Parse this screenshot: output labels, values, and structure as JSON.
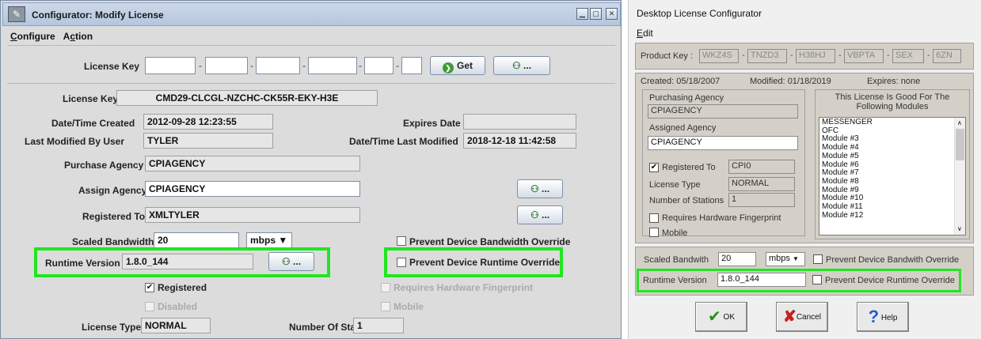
{
  "left": {
    "title": "Configurator: Modify License",
    "menu": [
      "Configure",
      "Action"
    ],
    "license_key_label": "License Key",
    "get_button": "Get",
    "more_button": "...",
    "key_display_label": "License Key",
    "key_display_value": "CMD29-CLCGL-NZCHC-CK55R-EKY-H3E",
    "created_label": "Date/Time Created",
    "created_value": "2012-09-28 12:23:55",
    "expires_label": "Expires Date",
    "expires_value": "",
    "modified_user_label": "Last Modified By User",
    "modified_user_value": "TYLER",
    "modified_label": "Date/Time Last Modified",
    "modified_value": "2018-12-18 11:42:58",
    "purchase_label": "Purchase Agency",
    "purchase_value": "CPIAGENCY",
    "assign_label": "Assign Agency",
    "assign_value": "CPIAGENCY",
    "registered_to_label": "Registered To",
    "registered_to_value": "XMLTYLER",
    "bandwidth_label": "Scaled Bandwidth",
    "bandwidth_value": "20",
    "bandwidth_unit": "mbps",
    "prevent_bandwidth": "Prevent Device Bandwidth Override",
    "runtime_label": "Runtime Version",
    "runtime_value": "1.8.0_144",
    "prevent_runtime": "Prevent Device Runtime Override",
    "registered": "Registered",
    "requires_hw": "Requires Hardware Fingerprint",
    "disabled": "Disabled",
    "mobile": "Mobile",
    "license_type_label": "License Type",
    "license_type_value": "NORMAL",
    "stations_label": "Number Of Stations",
    "stations_value": "1"
  },
  "right": {
    "title": "Desktop License Configurator",
    "menu": "Edit",
    "product_key_label": "Product Key :",
    "product_key": [
      "WKZ4S",
      "TNZD3",
      "H38HJ",
      "VBPTA",
      "SEX",
      "6ZN"
    ],
    "created": "Created: 05/18/2007",
    "modified": "Modified: 01/18/2019",
    "expires": "Expires: none",
    "purchasing_label": "Purchasing Agency",
    "purchasing_value": "CPIAGENCY",
    "assigned_label": "Assigned Agency",
    "assigned_value": "CPIAGENCY",
    "registered_to_label": "Registered To",
    "registered_to_value": "CPI0",
    "license_type_label": "License Type",
    "license_type_value": "NORMAL",
    "stations_label": "Number of Stations",
    "stations_value": "1",
    "requires_hw": "Requires Hardware Fingerprint",
    "mobile": "Mobile",
    "modules_header": "This License Is Good For The Following Modules",
    "modules": [
      "MESSENGER",
      "OFC",
      "Module #3",
      "Module #4",
      "Module #5",
      "Module #6",
      "Module #7",
      "Module #8",
      "Module #9",
      "Module #10",
      "Module #11",
      "Module #12"
    ],
    "bandwidth_label": "Scaled Bandwith",
    "bandwidth_value": "20",
    "bandwidth_unit": "mbps",
    "prevent_bandwidth": "Prevent Device Bandwith Override",
    "runtime_label": "Runtime Version",
    "runtime_value": "1.8.0_144",
    "prevent_runtime": "Prevent Device Runtime Override",
    "ok": "OK",
    "cancel": "Cancel",
    "help": "Help"
  },
  "colors": {
    "highlight": "#22e522"
  }
}
